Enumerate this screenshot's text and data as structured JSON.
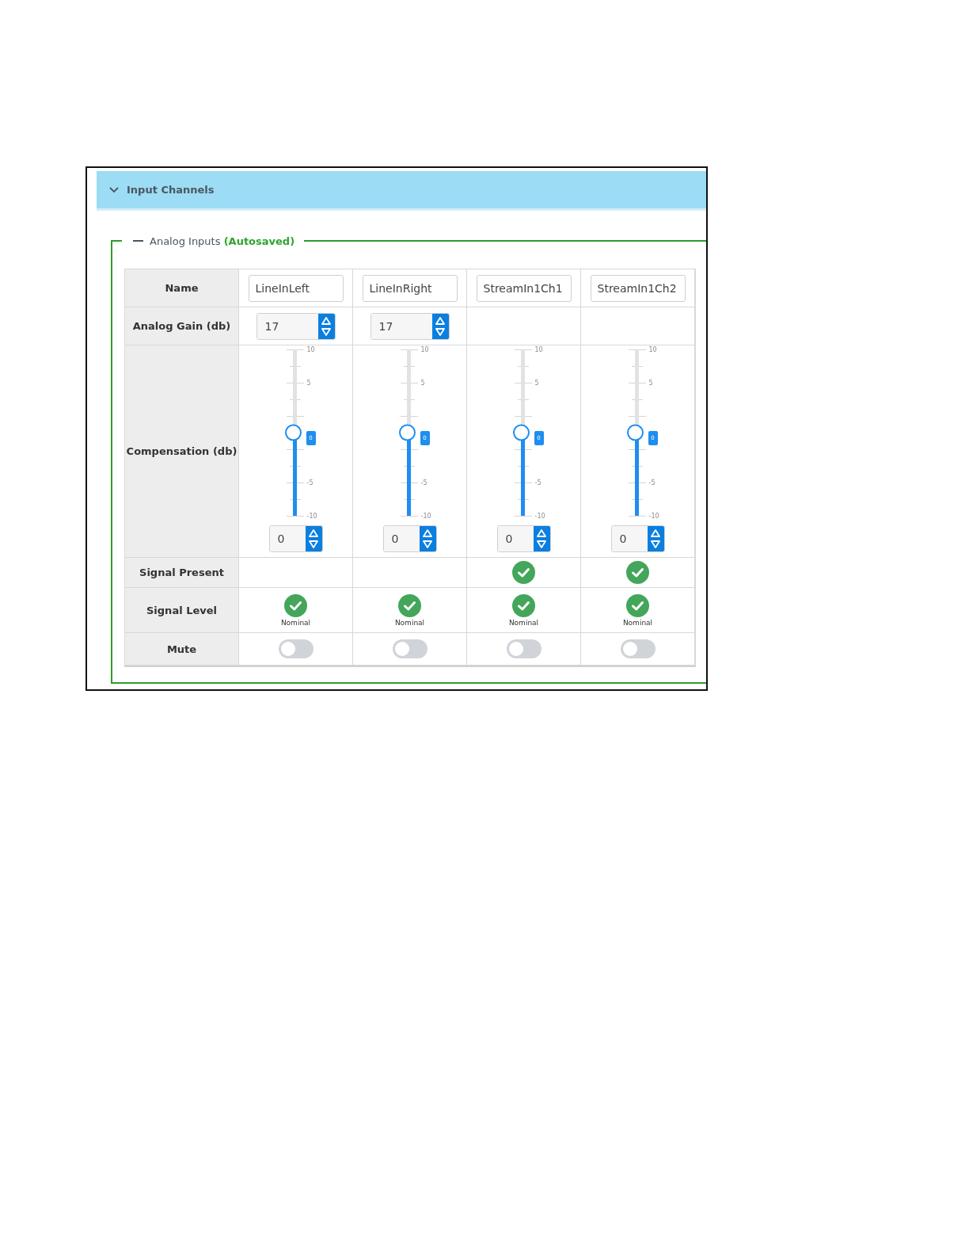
{
  "section": {
    "title": "Input Channels",
    "expanded": true
  },
  "group": {
    "title": "Analog Inputs",
    "status": "(Autosaved)",
    "expanded": true
  },
  "row_labels": [
    "Name",
    "Analog Gain (db)",
    "Compensation (db)",
    "Signal Present",
    "Signal Level",
    "Mute"
  ],
  "channels": [
    {
      "name": "LineInLeft",
      "gain": "17",
      "compensation": {
        "level": 0.5,
        "value": "0",
        "bubble": "0",
        "ticks": [
          "10",
          "5",
          "-5",
          "-10"
        ]
      },
      "signal_present": false,
      "signal_level": {
        "ok": true,
        "label": "Nominal"
      },
      "muted": false
    },
    {
      "name": "LineInRight",
      "gain": "17",
      "compensation": {
        "level": 0.5,
        "value": "0",
        "bubble": "0",
        "ticks": [
          "10",
          "5",
          "-5",
          "-10"
        ]
      },
      "signal_present": false,
      "signal_level": {
        "ok": true,
        "label": "Nominal"
      },
      "muted": false
    },
    {
      "name": "StreamIn1Ch1",
      "compensation": {
        "level": 0.5,
        "value": "0",
        "bubble": "0",
        "ticks": [
          "10",
          "5",
          "-5",
          "-10"
        ]
      },
      "signal_present": true,
      "signal_level": {
        "ok": true,
        "label": "Nominal"
      },
      "muted": false
    },
    {
      "name": "StreamIn1Ch2",
      "compensation": {
        "level": 0.5,
        "value": "0",
        "bubble": "0",
        "ticks": [
          "10",
          "5",
          "-5",
          "-10"
        ]
      },
      "signal_present": true,
      "signal_level": {
        "ok": true,
        "label": "Nominal"
      },
      "muted": false
    }
  ]
}
